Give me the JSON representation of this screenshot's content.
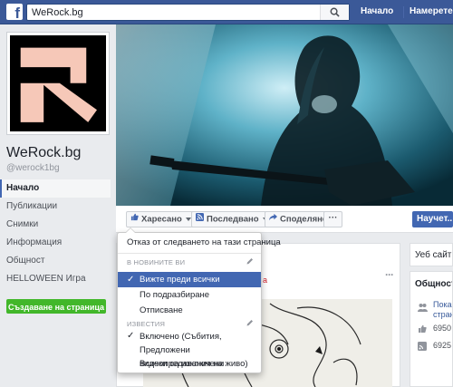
{
  "topbar": {
    "logo": "f",
    "search_value": "WeRock.bg",
    "nav_home": "Начало",
    "nav_find": "Намерете пр"
  },
  "page": {
    "name": "WeRock.bg",
    "handle": "@werock1bg"
  },
  "left_nav": {
    "items": [
      {
        "label": "Начало"
      },
      {
        "label": "Публикации"
      },
      {
        "label": "Снимки"
      },
      {
        "label": "Информация"
      },
      {
        "label": "Общност"
      },
      {
        "label": "HELLOWEEN Игра"
      }
    ],
    "create_page": "Създаване на страница"
  },
  "actions": {
    "like": "Харесано",
    "follow": "Последвано",
    "share": "Споделяне",
    "more": "···",
    "message": "Научет..."
  },
  "menu": {
    "unfollow": "Отказ от следването на тази страница",
    "section_feed": "В НОВИНИТЕ ВИ",
    "see_first": "Вижте преди всички",
    "default": "По подразбиране",
    "unfollow_short": "Отписване",
    "section_notifications": "ИЗВЕСТИЯ",
    "notif_on_line1": "Включено (Събития, Предложени",
    "notif_on_line2": "видеопредавания на живо)",
    "notif_off": "Всички са изключени"
  },
  "post": {
    "title_fragment": "а",
    "dots": "···"
  },
  "right": {
    "card1": "Уеб сайт",
    "community_title": "Общност",
    "invite_line1": "Пока",
    "invite_line2": "стран",
    "likes": "6950",
    "follows": "6925"
  },
  "colors": {
    "brand": "#3b5998",
    "accent": "#4267b2",
    "create_button": "#42b72a",
    "post_title": "#d2222d"
  }
}
